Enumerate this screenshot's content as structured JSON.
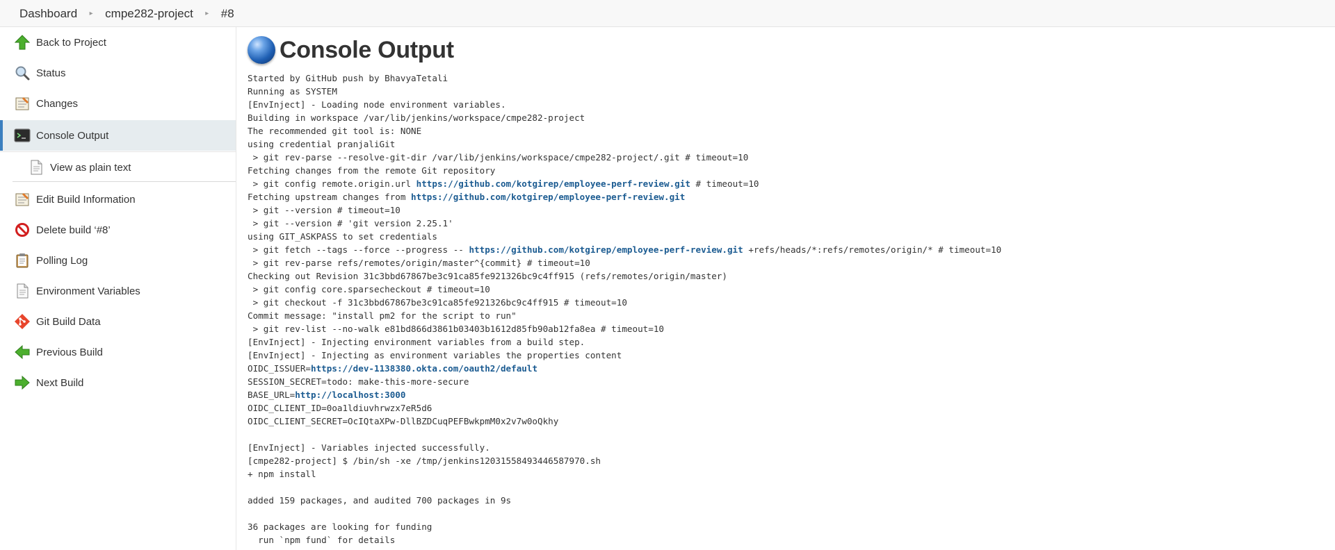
{
  "breadcrumb": {
    "items": [
      "Dashboard",
      "cmpe282-project",
      "#8"
    ]
  },
  "sidebar": {
    "items": [
      {
        "label": "Back to Project",
        "icon": "up-arrow-icon"
      },
      {
        "label": "Status",
        "icon": "magnifier-icon"
      },
      {
        "label": "Changes",
        "icon": "notepad-icon"
      },
      {
        "label": "Console Output",
        "icon": "terminal-icon"
      },
      {
        "label": "View as plain text",
        "icon": "document-icon"
      },
      {
        "label": "Edit Build Information",
        "icon": "notepad-edit-icon"
      },
      {
        "label": "Delete build ‘#8’",
        "icon": "no-entry-icon"
      },
      {
        "label": "Polling Log",
        "icon": "clipboard-icon"
      },
      {
        "label": "Environment Variables",
        "icon": "document-icon"
      },
      {
        "label": "Git Build Data",
        "icon": "git-icon"
      },
      {
        "label": "Previous Build",
        "icon": "left-arrow-icon"
      },
      {
        "label": "Next Build",
        "icon": "right-arrow-icon"
      }
    ],
    "active_index": 3
  },
  "main": {
    "title": "Console Output"
  },
  "colors": {
    "link": "#1b5b91",
    "active_bg": "#e6ecef",
    "active_bar": "#3b7fbf"
  },
  "console": {
    "lines": [
      [
        {
          "t": "Started by GitHub push by BhavyaTetali"
        }
      ],
      [
        {
          "t": "Running as SYSTEM"
        }
      ],
      [
        {
          "t": "[EnvInject] - Loading node environment variables."
        }
      ],
      [
        {
          "t": "Building in workspace /var/lib/jenkins/workspace/cmpe282-project"
        }
      ],
      [
        {
          "t": "The recommended git tool is: NONE"
        }
      ],
      [
        {
          "t": "using credential pranjaliGit"
        }
      ],
      [
        {
          "t": " > git rev-parse --resolve-git-dir /var/lib/jenkins/workspace/cmpe282-project/.git # timeout=10"
        }
      ],
      [
        {
          "t": "Fetching changes from the remote Git repository"
        }
      ],
      [
        {
          "t": " > git config remote.origin.url "
        },
        {
          "t": "https://github.com/kotgirep/employee-perf-review.git",
          "link": true
        },
        {
          "t": " # timeout=10"
        }
      ],
      [
        {
          "t": "Fetching upstream changes from "
        },
        {
          "t": "https://github.com/kotgirep/employee-perf-review.git",
          "link": true
        }
      ],
      [
        {
          "t": " > git --version # timeout=10"
        }
      ],
      [
        {
          "t": " > git --version # 'git version 2.25.1'"
        }
      ],
      [
        {
          "t": "using GIT_ASKPASS to set credentials"
        }
      ],
      [
        {
          "t": " > git fetch --tags --force --progress -- "
        },
        {
          "t": "https://github.com/kotgirep/employee-perf-review.git",
          "link": true
        },
        {
          "t": " +refs/heads/*:refs/remotes/origin/* # timeout=10"
        }
      ],
      [
        {
          "t": " > git rev-parse refs/remotes/origin/master^{commit} # timeout=10"
        }
      ],
      [
        {
          "t": "Checking out Revision 31c3bbd67867be3c91ca85fe921326bc9c4ff915 (refs/remotes/origin/master)"
        }
      ],
      [
        {
          "t": " > git config core.sparsecheckout # timeout=10"
        }
      ],
      [
        {
          "t": " > git checkout -f 31c3bbd67867be3c91ca85fe921326bc9c4ff915 # timeout=10"
        }
      ],
      [
        {
          "t": "Commit message: \"install pm2 for the script to run\""
        }
      ],
      [
        {
          "t": " > git rev-list --no-walk e81bd866d3861b03403b1612d85fb90ab12fa8ea # timeout=10"
        }
      ],
      [
        {
          "t": "[EnvInject] - Injecting environment variables from a build step."
        }
      ],
      [
        {
          "t": "[EnvInject] - Injecting as environment variables the properties content"
        }
      ],
      [
        {
          "t": "OIDC_ISSUER="
        },
        {
          "t": "https://dev-1138380.okta.com/oauth2/default",
          "link": true
        }
      ],
      [
        {
          "t": "SESSION_SECRET=todo: make-this-more-secure"
        }
      ],
      [
        {
          "t": "BASE_URL="
        },
        {
          "t": "http://localhost:3000",
          "link": true
        }
      ],
      [
        {
          "t": "OIDC_CLIENT_ID=0oa1ldiuvhrwzx7eR5d6"
        }
      ],
      [
        {
          "t": "OIDC_CLIENT_SECRET=OcIQtaXPw-DllBZDCuqPEFBwkpmM0x2v7w0oQkhy"
        }
      ],
      [
        {
          "t": ""
        }
      ],
      [
        {
          "t": "[EnvInject] - Variables injected successfully."
        }
      ],
      [
        {
          "t": "[cmpe282-project] $ /bin/sh -xe /tmp/jenkins12031558493446587970.sh"
        }
      ],
      [
        {
          "t": "+ npm install"
        }
      ],
      [
        {
          "t": ""
        }
      ],
      [
        {
          "t": "added 159 packages, and audited 700 packages in 9s"
        }
      ],
      [
        {
          "t": ""
        }
      ],
      [
        {
          "t": "36 packages are looking for funding"
        }
      ],
      [
        {
          "t": "  run `npm fund` for details"
        }
      ]
    ]
  }
}
